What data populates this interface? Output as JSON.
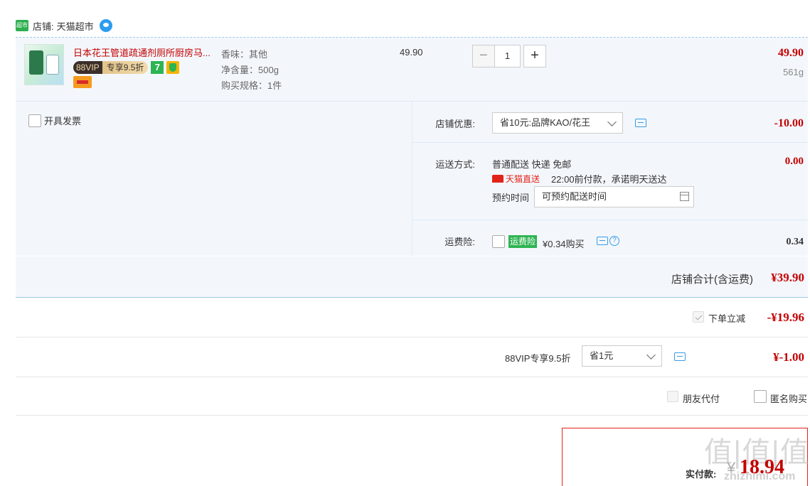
{
  "shop": {
    "badge": "超市",
    "label": "店铺:",
    "name": "天猫超市"
  },
  "item": {
    "title": "日本花王管道疏通剂厕所厨房马...",
    "vip_label": "88VIP",
    "vip_discount": "专享9.5折",
    "badge_seven": "7",
    "attrs": [
      "香味：其他",
      "净含量：500g",
      "购买规格：1件"
    ],
    "unit_price": "49.90",
    "quantity": "1",
    "total": "49.90",
    "weight": "561g"
  },
  "invoice": {
    "label": "开具发票"
  },
  "shop_discount": {
    "label": "店铺优惠:",
    "selected": "省10元:品牌KAO/花王",
    "amount": "-10.00"
  },
  "shipping": {
    "label": "运送方式:",
    "method": "普通配送 快递 免邮",
    "tmall_direct": "天猫直送",
    "promise": "22:00前付款，承诺明天送达",
    "schedule_label": "预约时间",
    "schedule_placeholder": "可预约配送时间",
    "amount": "0.00"
  },
  "insurance": {
    "label": "运费险:",
    "badge": "运费险",
    "price_text": "¥0.34购买",
    "help": "?",
    "amount": "0.34"
  },
  "subtotal": {
    "label": "店铺合计(含运费)",
    "amount": "¥39.90"
  },
  "instant_discount": {
    "label": "下单立减",
    "amount": "-¥19.96"
  },
  "vip_discount": {
    "label": "88VIP专享9.5折",
    "selected": "省1元",
    "amount": "¥-1.00"
  },
  "options": {
    "friend_pay": "朋友代付",
    "anonymous": "匿名购买"
  },
  "payment": {
    "label": "实付款:",
    "currency": "¥",
    "amount": "18.94"
  },
  "watermark": {
    "line1": "值|值|值",
    "line2": "zhizhimi.com"
  },
  "colors": {
    "accent_red": "#c40000",
    "tmall_red": "#e2231a",
    "green": "#2eb452",
    "panel_bg": "#f3f7fc",
    "link_blue": "#3a9be6"
  }
}
